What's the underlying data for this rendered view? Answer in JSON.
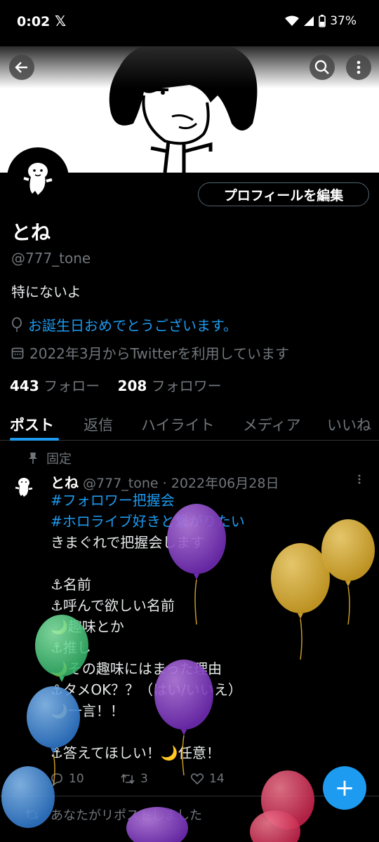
{
  "status_bar": {
    "time": "0:02",
    "x_glyph": "𝕏",
    "battery": "37%"
  },
  "header": {
    "back_icon": "arrow-left-icon",
    "search_icon": "search-icon",
    "more_icon": "more-vertical-icon"
  },
  "profile": {
    "edit_button_label": "プロフィールを編集",
    "display_name": "とね",
    "handle": "@777_tone",
    "bio": "特にないよ",
    "birthday_text": "お誕生日おめでとうございます。",
    "joined_text": "2022年3月からTwitterを利用しています",
    "following_count": "443",
    "following_label": "フォロー",
    "followers_count": "208",
    "followers_label": "フォロワー"
  },
  "tabs": [
    {
      "label": "ポスト"
    },
    {
      "label": "返信"
    },
    {
      "label": "ハイライト"
    },
    {
      "label": "メディア"
    },
    {
      "label": "いいね"
    }
  ],
  "post": {
    "pinned_label": "固定",
    "author": "とね",
    "meta": "@777_tone · 2022年06月28日",
    "hashtag1": "#フォロワー把握会",
    "hashtag2": "#ホロライブ好きと繋がりたい",
    "lines": [
      "きまぐれで把握会します",
      "⚓名前",
      "⚓呼んで欲しい名前",
      "🌙趣味とか",
      "⚓推し",
      "🌙その趣味にはまった理由",
      "⚓タメOK？？（はい/いいえ）",
      "🌙一言！！",
      "⚓答えてほしい！🌙任意！"
    ],
    "replies": "10",
    "reposts": "3",
    "likes": "14"
  },
  "next_item": {
    "repost_note": "あなたがリポストしました"
  },
  "fab": {
    "label": "+"
  },
  "colors": {
    "accent": "#1d9bf0",
    "background": "#000000",
    "muted": "#71767b"
  }
}
